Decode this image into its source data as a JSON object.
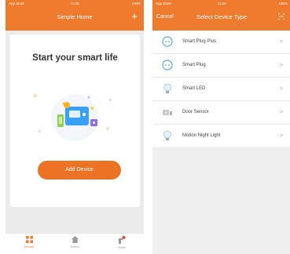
{
  "left_screen": {
    "status_bar": {
      "carrier": "App Store",
      "time": "11:30",
      "battery": "100%"
    },
    "header": {
      "title": "Simple Home",
      "add_symbol": "+"
    },
    "card": {
      "headline": "Start your smart life",
      "button_label": "Add Device"
    },
    "tab_bar": {
      "tabs": [
        {
          "label": "Devices",
          "icon": "grid-icon",
          "active": true
        },
        {
          "label": "Scenes",
          "icon": "home-icon",
          "active": false
        },
        {
          "label": "Profile",
          "icon": "profile-icon",
          "active": false
        }
      ]
    }
  },
  "right_screen": {
    "status_bar": {
      "carrier": "App Store",
      "time": "11:30",
      "battery": "100%"
    },
    "header": {
      "cancel_label": "Cancel",
      "title": "Select Device Type",
      "scan_icon": "scan-icon"
    },
    "devices": [
      {
        "label": "Smart Plug Plus",
        "icon": "plug-icon"
      },
      {
        "label": "Smart Plug",
        "icon": "plug-icon"
      },
      {
        "label": "Smart LED",
        "icon": "bulb-icon"
      },
      {
        "label": "Door Sensor",
        "icon": "door-sensor-icon"
      },
      {
        "label": "Motion Night Light",
        "icon": "bulb-icon"
      }
    ],
    "chevron": ">"
  },
  "colors": {
    "accent": "#ee7a2d",
    "button": "#ec7224",
    "background": "#ececec"
  }
}
